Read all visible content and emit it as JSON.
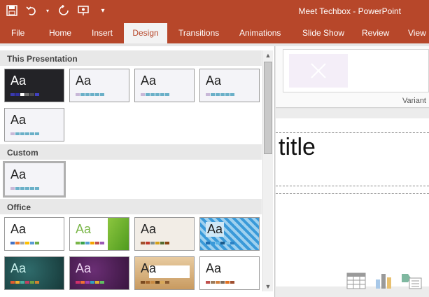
{
  "app": {
    "title": "Meet Techbox  -  PowerPoint"
  },
  "tabs": [
    "File",
    "Home",
    "Insert",
    "Design",
    "Transitions",
    "Animations",
    "Slide Show",
    "Review",
    "View"
  ],
  "gallery": {
    "sections": [
      "This Presentation",
      "Custom",
      "Office"
    ],
    "thumb_label": "Aa"
  },
  "right": {
    "variants_label": "Variant"
  },
  "slide": {
    "title_placeholder": "title"
  },
  "colors": {
    "accent": "#b7472a",
    "tab_active_text": "#b7472a"
  }
}
